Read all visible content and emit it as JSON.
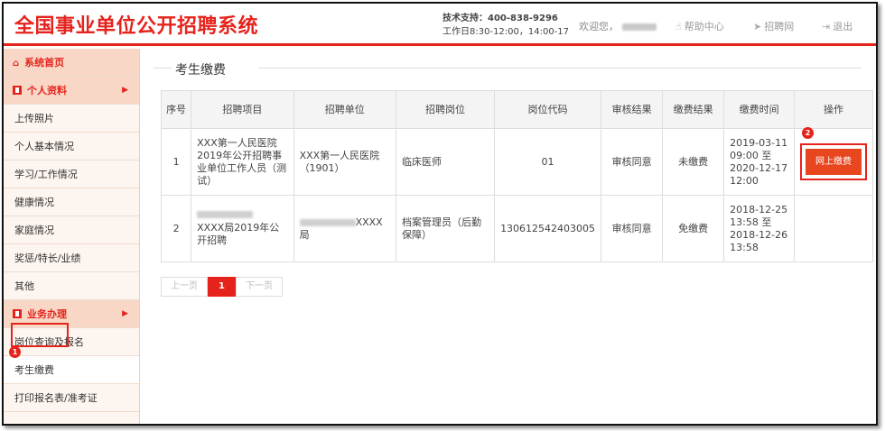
{
  "app": {
    "title": "全国事业单位公开招聘系统"
  },
  "header": {
    "support_line1": "技术支持：400-838-9296",
    "support_line2": "工作日8:30-12:00，14:00-17",
    "welcome": "欢迎您，",
    "links": [
      {
        "label": "帮助中心",
        "icon": "hand-icon"
      },
      {
        "label": "招聘网",
        "icon": "send-icon"
      },
      {
        "label": "退出",
        "icon": "logout-icon"
      }
    ]
  },
  "sidebar": {
    "home": "系统首页",
    "section1": "个人资料",
    "items1": [
      "上传照片",
      "个人基本情况",
      "学习/工作情况",
      "健康情况",
      "家庭情况",
      "奖惩/特长/业绩",
      "其他"
    ],
    "section2": "业务办理",
    "items2": [
      "岗位查询及报名",
      "考生缴费",
      "打印报名表/准考证"
    ]
  },
  "annotations": {
    "badge1": "1",
    "badge2": "2"
  },
  "main": {
    "title": "考生缴费",
    "columns": [
      "序号",
      "招聘项目",
      "招聘单位",
      "招聘岗位",
      "岗位代码",
      "审核结果",
      "缴费结果",
      "缴费时间",
      "操作"
    ],
    "rows": [
      {
        "no": "1",
        "project": "XXX第一人民医院2019年公开招聘事业单位工作人员（测试）",
        "unit": "XXX第一人民医院（1901）",
        "position": "临床医师",
        "code": "01",
        "audit": "审核同意",
        "payment": "未缴费",
        "time": "2019-03-11 09:00 至 2020-12-17 12:00",
        "action": "网上缴费"
      },
      {
        "no": "2",
        "project": "XXXX局2019年公开招聘",
        "unit_visible": "XXXX",
        "unit_suffix": "局",
        "position": "档案管理员（后勤保障）",
        "code": "130612542403005",
        "audit": "审核同意",
        "payment": "免缴费",
        "time": "2018-12-25 13:58 至 2018-12-26 13:58",
        "action": ""
      }
    ],
    "pager": {
      "prev": "上一页",
      "current": "1",
      "next": "下一页"
    }
  },
  "colors": {
    "brand": "#e5231c",
    "button": "#e8461e",
    "sidebar_bg": "#fdf5ef",
    "sidebar_head": "#f8d7c6"
  }
}
